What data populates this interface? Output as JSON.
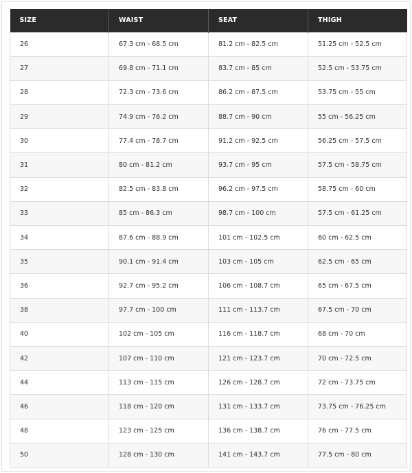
{
  "table": {
    "headers": [
      "SIZE",
      "WAIST",
      "SEAT",
      "THIGH"
    ],
    "rows": [
      [
        "26",
        "67.3 cm - 68.5 cm",
        "81.2 cm - 82.5 cm",
        "51.25 cm - 52.5 cm"
      ],
      [
        "27",
        "69.8 cm - 71.1 cm",
        "83.7 cm - 85 cm",
        "52.5 cm - 53.75 cm"
      ],
      [
        "28",
        "72.3 cm - 73.6 cm",
        "86.2 cm - 87.5 cm",
        "53.75 cm - 55 cm"
      ],
      [
        "29",
        "74.9 cm - 76.2 cm",
        "88.7 cm - 90 cm",
        "55 cm - 56.25 cm"
      ],
      [
        "30",
        "77.4 cm - 78.7 cm",
        "91.2 cm - 92.5 cm",
        "56.25 cm - 57.5 cm"
      ],
      [
        "31",
        "80 cm - 81.2 cm",
        "93.7 cm - 95 cm",
        "57.5 cm - 58.75 cm"
      ],
      [
        "32",
        "82.5 cm - 83.8 cm",
        "96.2 cm - 97.5 cm",
        "58.75 cm - 60 cm"
      ],
      [
        "33",
        "85 cm - 86.3 cm",
        "98.7 cm - 100 cm",
        "57.5 cm - 61.25 cm"
      ],
      [
        "34",
        "87.6 cm - 88.9 cm",
        "101 cm - 102.5 cm",
        "60 cm - 62.5 cm"
      ],
      [
        "35",
        "90.1 cm - 91.4 cm",
        "103 cm - 105 cm",
        "62.5 cm - 65 cm"
      ],
      [
        "36",
        "92.7 cm - 95.2 cm",
        "106 cm - 108.7 cm",
        "65 cm - 67.5 cm"
      ],
      [
        "38",
        "97.7 cm - 100 cm",
        "111 cm - 113.7 cm",
        "67.5 cm - 70 cm"
      ],
      [
        "40",
        "102 cm - 105 cm",
        "116 cm - 118.7 cm",
        "68 cm - 70 cm"
      ],
      [
        "42",
        "107 cm - 110 cm",
        "121 cm - 123.7 cm",
        "70 cm - 72.5 cm"
      ],
      [
        "44",
        "113 cm - 115 cm",
        "126 cm - 128.7 cm",
        "72 cm - 73.75 cm"
      ],
      [
        "46",
        "118 cm - 120 cm",
        "131 cm - 133.7 cm",
        "73.75 cm - 76.25 cm"
      ],
      [
        "48",
        "123 cm - 125 cm",
        "136 cm - 138.7 cm",
        "76 cm - 77.5 cm"
      ],
      [
        "50",
        "128 cm - 130 cm",
        "141 cm - 143.7 cm",
        "77.5 cm - 80 cm"
      ]
    ]
  },
  "colors": {
    "header_background": "#2b2b2b",
    "header_text": "#ffffff",
    "row_alt_background": "#f7f7f7",
    "grid_line": "#dcdcdc"
  }
}
